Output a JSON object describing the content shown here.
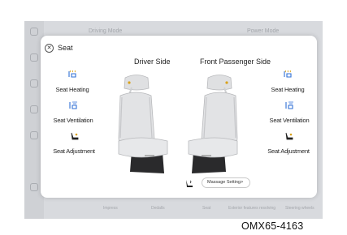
{
  "background": {
    "header_left": "Driving Mode",
    "header_right": "Power Mode",
    "footer_items": [
      "Impress",
      "Dedalls",
      "Seat",
      "Exterior features resolving",
      "Steering wheels"
    ],
    "rail_icons": [
      "home-icon",
      "car-icon",
      "light-icon",
      "climate-icon",
      "seat-icon",
      "settings-icon"
    ]
  },
  "dialog": {
    "title": "Seat",
    "close_icon": "close-icon",
    "driver_label": "Driver Side",
    "passenger_label": "Front Passenger Side",
    "driver_controls": [
      {
        "label": "Seat Heating",
        "icon": "seat-heating-icon"
      },
      {
        "label": "Seat Ventilation",
        "icon": "seat-ventilation-icon"
      },
      {
        "label": "Seat Adjustment",
        "icon": "seat-adjustment-icon"
      }
    ],
    "passenger_controls": [
      {
        "label": "Seat Heating",
        "icon": "seat-heating-icon"
      },
      {
        "label": "Seat Ventilation",
        "icon": "seat-ventilation-icon"
      },
      {
        "label": "Seat Adjustment",
        "icon": "seat-adjustment-icon"
      }
    ],
    "massage_label": "Massage Setting",
    "massage_chevron": ">",
    "massage_icon": "massage-icon"
  },
  "caption": "OMX65-4163",
  "colors": {
    "accent": "#2f6fd6",
    "highlight": "#d9a21a",
    "seat": "#dfe0e2",
    "base": "#2a2a2c"
  }
}
